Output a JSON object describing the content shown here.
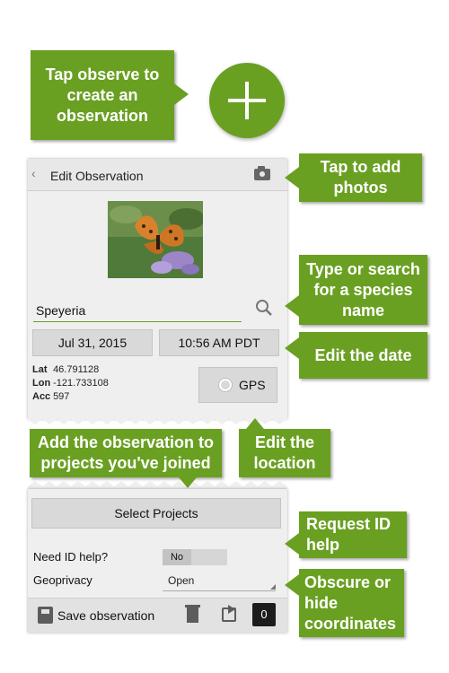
{
  "callouts": {
    "observe": "Tap observe to create an observation",
    "photos": "Tap to add photos",
    "species": "Type or search for a species name",
    "date": "Edit the date",
    "projects": "Add the observation to projects you've joined",
    "location": "Edit the location",
    "request_id": "Request ID help",
    "obscure": "Obscure or hide coordinates"
  },
  "header": {
    "back": "‹",
    "title": "Edit Observation"
  },
  "species_field": {
    "value": "Speyeria"
  },
  "date_button": "Jul 31, 2015",
  "time_button": "10:56 AM PDT",
  "coords": {
    "lat_label": "Lat",
    "lat": "46.791128",
    "lon_label": "Lon",
    "lon": "-121.733108",
    "acc_label": "Acc",
    "acc": "597"
  },
  "gps_button": "GPS",
  "projects_button": "Select Projects",
  "id_help": {
    "label": "Need ID help?",
    "value": "No"
  },
  "geoprivacy": {
    "label": "Geoprivacy",
    "value": "Open"
  },
  "footer": {
    "save": "Save observation",
    "count": "0"
  },
  "colors": {
    "accent": "#6aa022",
    "panel": "#efefef"
  }
}
